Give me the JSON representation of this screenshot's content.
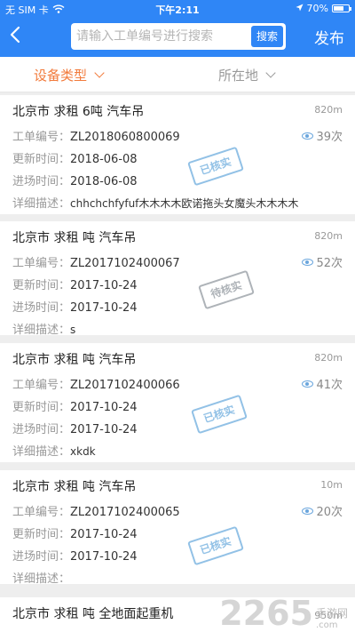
{
  "status": {
    "carrier": "无 SIM 卡",
    "time": "下午2:11",
    "battery_text": "70%",
    "battery_level": 0.7
  },
  "header": {
    "search_placeholder": "请输入工单编号进行搜索",
    "search_button": "搜索",
    "publish_button": "发布",
    "color": "#2f86f6"
  },
  "filters": {
    "type_label": "设备类型",
    "location_label": "所在地",
    "active_color": "#f27b3c"
  },
  "labels": {
    "order_no": "工单编号：",
    "updated": "更新时间：",
    "entered": "进场时间：",
    "detail": "详细描述：",
    "views_suffix": "次"
  },
  "cards": [
    {
      "title": "北京市 求租 6吨 汽车吊",
      "distance": "820m",
      "order_no": "ZL2018060800069",
      "updated": "2018-06-08",
      "entered": "2018-06-08",
      "detail": "chhchchfyfuf木木木木欧诺拖头女魔头木木木木",
      "views": "39次",
      "stamp": "已核实",
      "stamp_state": "verified"
    },
    {
      "title": "北京市 求租 吨 汽车吊",
      "distance": "820m",
      "order_no": "ZL2017102400067",
      "updated": "2017-10-24",
      "entered": "2017-10-24",
      "detail": "s",
      "views": "52次",
      "stamp": "待核实",
      "stamp_state": "pending"
    },
    {
      "title": "北京市 求租 吨 汽车吊",
      "distance": "820m",
      "order_no": "ZL2017102400066",
      "updated": "2017-10-24",
      "entered": "2017-10-24",
      "detail": "xkdk",
      "views": "41次",
      "stamp": "已核实",
      "stamp_state": "verified"
    },
    {
      "title": "北京市 求租 吨 汽车吊",
      "distance": "10m",
      "order_no": "ZL2017102400065",
      "updated": "2017-10-24",
      "entered": "2017-10-24",
      "detail": "",
      "views": "20次",
      "stamp": "已核实",
      "stamp_state": "verified"
    },
    {
      "title": "北京市 求租 吨 全地面起重机",
      "distance": "950m"
    }
  ],
  "watermark": {
    "number": "2265",
    "cn": "手游网",
    "com": ".com"
  }
}
